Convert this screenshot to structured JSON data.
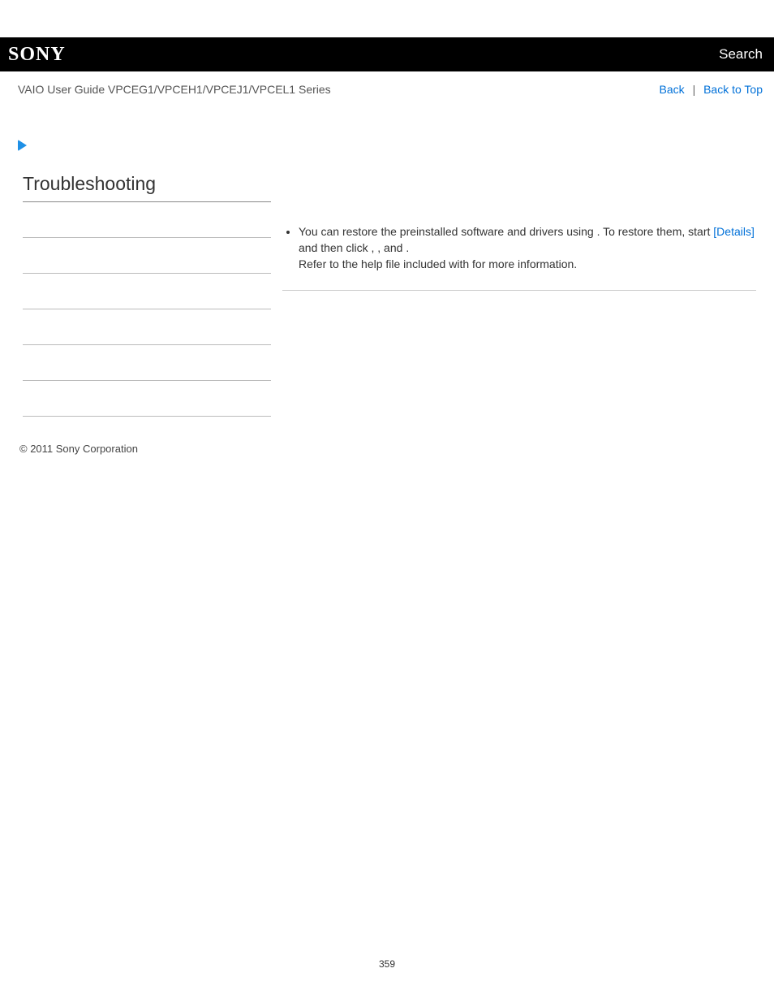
{
  "header": {
    "logo_text": "SONY",
    "search_label": "Search"
  },
  "subheader": {
    "guide_title": "VAIO User Guide VPCEG1/VPCEH1/VPCEJ1/VPCEL1 Series",
    "back_label": "Back",
    "back_to_top_label": "Back to Top",
    "separator": "|"
  },
  "page": {
    "title": "Troubleshooting"
  },
  "sidebar": {
    "items": [
      {
        "label": ""
      },
      {
        "label": ""
      },
      {
        "label": ""
      },
      {
        "label": ""
      },
      {
        "label": ""
      },
      {
        "label": ""
      }
    ]
  },
  "main": {
    "bullet": {
      "part1": "You can restore the preinstalled software and drivers using ",
      "part2": ". To restore them, start ",
      "details_link": "[Details]",
      "part3": " and then click ",
      "part4": ", ",
      "part5": ", and ",
      "part6": ".",
      "part7": "Refer to the help file included with ",
      "part8": " for more information."
    }
  },
  "footer": {
    "copyright": "© 2011 Sony Corporation",
    "page_number": "359"
  }
}
